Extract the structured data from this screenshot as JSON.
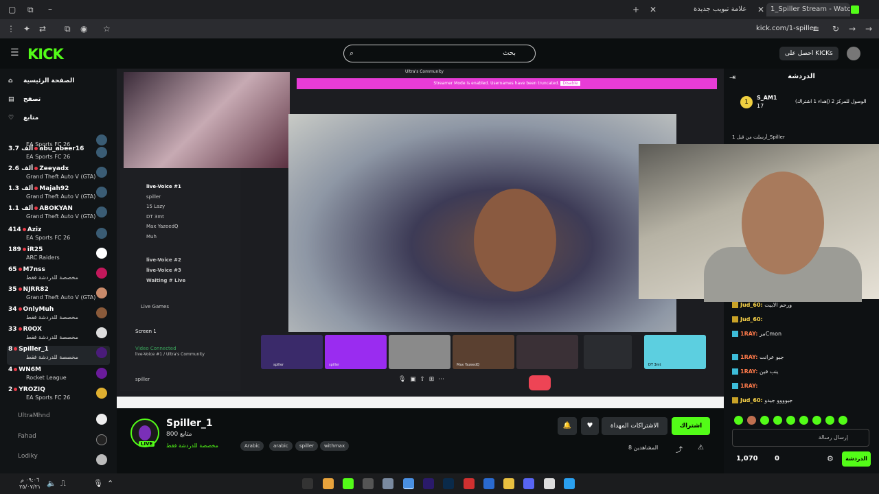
{
  "browser": {
    "tabs": [
      {
        "label": "1_Spiller Stream - Watch Live o",
        "active": true
      },
      {
        "label": "علامة تبويب جديدة",
        "active": false
      }
    ],
    "url": "kick.com/1-spiller"
  },
  "header": {
    "logo": "KICK",
    "search_placeholder": "بحث",
    "get_kicks": "احصل على KICKs"
  },
  "sidebar": {
    "nav": [
      {
        "label": "الصفحة الرئيسية",
        "icon": "home-icon"
      },
      {
        "label": "تصفح",
        "icon": "browse-icon"
      },
      {
        "label": "متابع",
        "icon": "heart-icon"
      }
    ],
    "channels": [
      {
        "name": "",
        "category": "EA Sports FC 26"
      },
      {
        "name": "abu_abeer16",
        "viewers": "3.7 ألف",
        "category": "EA Sports FC 26"
      },
      {
        "name": "Zeeyadx",
        "viewers": "2.6 ألف",
        "category": "Grand Theft Auto V (GTA)"
      },
      {
        "name": "Majah92",
        "viewers": "1.3 ألف",
        "category": "Grand Theft Auto V (GTA)"
      },
      {
        "name": "ABOKYAN",
        "viewers": "1.1 ألف",
        "category": "Grand Theft Auto V (GTA)"
      },
      {
        "name": "Aziz",
        "viewers": "414",
        "category": "EA Sports FC 26"
      },
      {
        "name": "iR25",
        "viewers": "189",
        "category": "ARC Raiders"
      },
      {
        "name": "M7nss",
        "viewers": "65",
        "category": "مخصصة للدردشة فقط"
      },
      {
        "name": "NJRR82",
        "viewers": "35",
        "category": "Grand Theft Auto V (GTA)"
      },
      {
        "name": "OnlyMuh",
        "viewers": "34",
        "category": "مخصصة للدردشة فقط"
      },
      {
        "name": "R0OX",
        "viewers": "33",
        "category": "مخصصة للدردشة فقط"
      },
      {
        "name": "Spiller_1",
        "viewers": "8",
        "category": "مخصصة للدردشة فقط",
        "selected": true
      },
      {
        "name": "WN6M",
        "viewers": "4",
        "category": "Rocket League"
      },
      {
        "name": "YROZIQ",
        "viewers": "2",
        "category": "EA Sports FC 26"
      }
    ],
    "offline": [
      "UltraMhnd",
      "Fahad",
      "Lodiky"
    ]
  },
  "stream": {
    "overlay_title": "Ultra's Community",
    "streamer_mode": "Streamer Mode is enabled. Usernames have been truncated.",
    "disable_label": "Disable",
    "discord": {
      "channel": "live-Voice #1",
      "members": [
        "spiller",
        "15 Lazy",
        "DT 3mt",
        "Max YazeedQ",
        "Muh"
      ],
      "voice_channels": [
        "live-Voice #2",
        "live-Voice #3",
        "Waiting # Live"
      ],
      "live_games": "Live Games",
      "screen": "Screen 1",
      "video_connected": "Video Connected",
      "video_sub": "live-Voice #1 / Ultra's Community",
      "user": "spiller"
    },
    "thumbs": [
      "spiller",
      "spiller",
      "",
      "Max YazeedQ",
      "",
      "",
      "DT 3mt"
    ]
  },
  "info": {
    "streamer": "Spiller_1",
    "followers": "800 متابع",
    "live_label": "LIVE",
    "category": "مخصصة للدردشة فقط",
    "tags": [
      "Arabic",
      "arabic",
      "spiller",
      "withmax"
    ],
    "subscribe": "اشتراك",
    "gift_subs": "الاشتراكات المهداة",
    "viewers": "8 المشاهدين"
  },
  "chat": {
    "title": "الدردشة",
    "pinned_user": "S_AM1",
    "pinned_count": "17",
    "pinned_text": "(إهداء 1 اشتراك) الوصول للمركز 2",
    "host_line": "أرسلت من قبل 1_Spiller",
    "messages": [
      {
        "user": "Jud_60:",
        "text": "ورحم الابيت"
      },
      {
        "user": "Jud_60:",
        "text": ""
      },
      {
        "user": "1RAY:",
        "text": "مرCmon"
      },
      {
        "user": "1RAY:",
        "text": "جيو عرانت"
      },
      {
        "user": "1RAY:",
        "text": "ينب فين"
      },
      {
        "user": "1RAY:",
        "text": ""
      },
      {
        "user": "Jud_60:",
        "text": "جيوووو جيدو"
      }
    ],
    "input_placeholder": "إرسال رسالة",
    "send": "الدردشة",
    "kicks": "1,070",
    "zero": "0"
  },
  "taskbar": {
    "time": "٠٩:٠٦ م",
    "date": "٢٥/٠٧/٢١"
  },
  "colors": {
    "accent": "#53fc18",
    "live_red": "#e63946",
    "discord_pink": "#e83cd7"
  }
}
